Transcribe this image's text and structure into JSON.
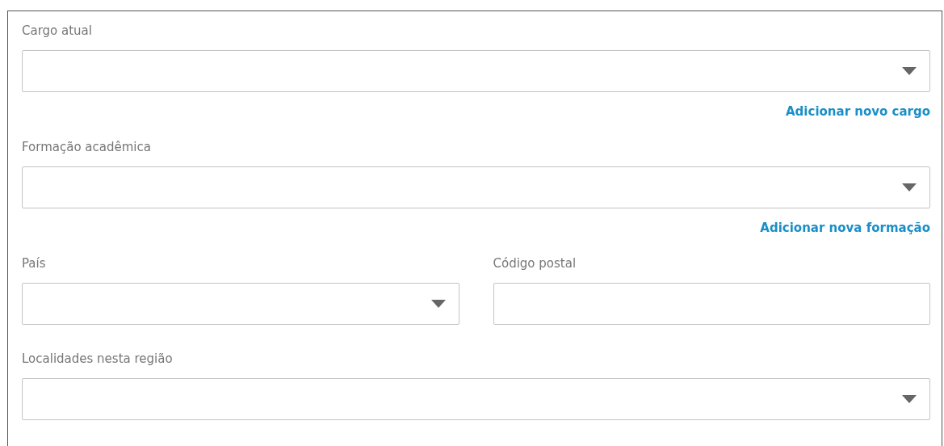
{
  "sections": [
    {
      "fields": [
        {
          "label": "Cargo atual",
          "kind": "select"
        }
      ],
      "link": "Adicionar novo cargo"
    },
    {
      "fields": [
        {
          "label": "Formação acadêmica",
          "kind": "select"
        }
      ],
      "link": "Adicionar nova formação"
    },
    {
      "fields": [
        {
          "label": "País",
          "kind": "select"
        },
        {
          "label": "Código postal",
          "kind": "text"
        }
      ]
    },
    {
      "fields": [
        {
          "label": "Localidades nesta região",
          "kind": "select"
        }
      ]
    }
  ]
}
